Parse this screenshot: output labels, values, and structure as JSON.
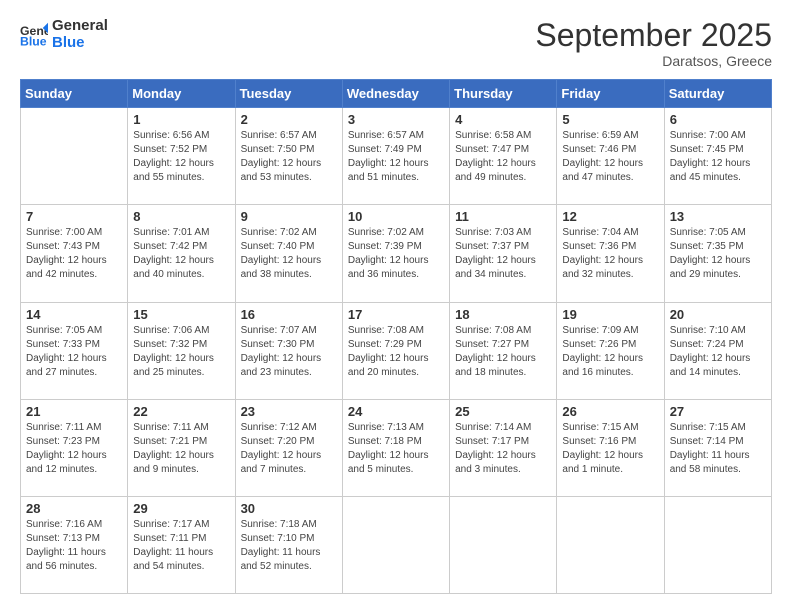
{
  "header": {
    "logo_line1": "General",
    "logo_line2": "Blue",
    "month": "September 2025",
    "location": "Daratsos, Greece"
  },
  "weekdays": [
    "Sunday",
    "Monday",
    "Tuesday",
    "Wednesday",
    "Thursday",
    "Friday",
    "Saturday"
  ],
  "weeks": [
    [
      {
        "day": "",
        "info": ""
      },
      {
        "day": "1",
        "info": "Sunrise: 6:56 AM\nSunset: 7:52 PM\nDaylight: 12 hours\nand 55 minutes."
      },
      {
        "day": "2",
        "info": "Sunrise: 6:57 AM\nSunset: 7:50 PM\nDaylight: 12 hours\nand 53 minutes."
      },
      {
        "day": "3",
        "info": "Sunrise: 6:57 AM\nSunset: 7:49 PM\nDaylight: 12 hours\nand 51 minutes."
      },
      {
        "day": "4",
        "info": "Sunrise: 6:58 AM\nSunset: 7:47 PM\nDaylight: 12 hours\nand 49 minutes."
      },
      {
        "day": "5",
        "info": "Sunrise: 6:59 AM\nSunset: 7:46 PM\nDaylight: 12 hours\nand 47 minutes."
      },
      {
        "day": "6",
        "info": "Sunrise: 7:00 AM\nSunset: 7:45 PM\nDaylight: 12 hours\nand 45 minutes."
      }
    ],
    [
      {
        "day": "7",
        "info": "Sunrise: 7:00 AM\nSunset: 7:43 PM\nDaylight: 12 hours\nand 42 minutes."
      },
      {
        "day": "8",
        "info": "Sunrise: 7:01 AM\nSunset: 7:42 PM\nDaylight: 12 hours\nand 40 minutes."
      },
      {
        "day": "9",
        "info": "Sunrise: 7:02 AM\nSunset: 7:40 PM\nDaylight: 12 hours\nand 38 minutes."
      },
      {
        "day": "10",
        "info": "Sunrise: 7:02 AM\nSunset: 7:39 PM\nDaylight: 12 hours\nand 36 minutes."
      },
      {
        "day": "11",
        "info": "Sunrise: 7:03 AM\nSunset: 7:37 PM\nDaylight: 12 hours\nand 34 minutes."
      },
      {
        "day": "12",
        "info": "Sunrise: 7:04 AM\nSunset: 7:36 PM\nDaylight: 12 hours\nand 32 minutes."
      },
      {
        "day": "13",
        "info": "Sunrise: 7:05 AM\nSunset: 7:35 PM\nDaylight: 12 hours\nand 29 minutes."
      }
    ],
    [
      {
        "day": "14",
        "info": "Sunrise: 7:05 AM\nSunset: 7:33 PM\nDaylight: 12 hours\nand 27 minutes."
      },
      {
        "day": "15",
        "info": "Sunrise: 7:06 AM\nSunset: 7:32 PM\nDaylight: 12 hours\nand 25 minutes."
      },
      {
        "day": "16",
        "info": "Sunrise: 7:07 AM\nSunset: 7:30 PM\nDaylight: 12 hours\nand 23 minutes."
      },
      {
        "day": "17",
        "info": "Sunrise: 7:08 AM\nSunset: 7:29 PM\nDaylight: 12 hours\nand 20 minutes."
      },
      {
        "day": "18",
        "info": "Sunrise: 7:08 AM\nSunset: 7:27 PM\nDaylight: 12 hours\nand 18 minutes."
      },
      {
        "day": "19",
        "info": "Sunrise: 7:09 AM\nSunset: 7:26 PM\nDaylight: 12 hours\nand 16 minutes."
      },
      {
        "day": "20",
        "info": "Sunrise: 7:10 AM\nSunset: 7:24 PM\nDaylight: 12 hours\nand 14 minutes."
      }
    ],
    [
      {
        "day": "21",
        "info": "Sunrise: 7:11 AM\nSunset: 7:23 PM\nDaylight: 12 hours\nand 12 minutes."
      },
      {
        "day": "22",
        "info": "Sunrise: 7:11 AM\nSunset: 7:21 PM\nDaylight: 12 hours\nand 9 minutes."
      },
      {
        "day": "23",
        "info": "Sunrise: 7:12 AM\nSunset: 7:20 PM\nDaylight: 12 hours\nand 7 minutes."
      },
      {
        "day": "24",
        "info": "Sunrise: 7:13 AM\nSunset: 7:18 PM\nDaylight: 12 hours\nand 5 minutes."
      },
      {
        "day": "25",
        "info": "Sunrise: 7:14 AM\nSunset: 7:17 PM\nDaylight: 12 hours\nand 3 minutes."
      },
      {
        "day": "26",
        "info": "Sunrise: 7:15 AM\nSunset: 7:16 PM\nDaylight: 12 hours\nand 1 minute."
      },
      {
        "day": "27",
        "info": "Sunrise: 7:15 AM\nSunset: 7:14 PM\nDaylight: 11 hours\nand 58 minutes."
      }
    ],
    [
      {
        "day": "28",
        "info": "Sunrise: 7:16 AM\nSunset: 7:13 PM\nDaylight: 11 hours\nand 56 minutes."
      },
      {
        "day": "29",
        "info": "Sunrise: 7:17 AM\nSunset: 7:11 PM\nDaylight: 11 hours\nand 54 minutes."
      },
      {
        "day": "30",
        "info": "Sunrise: 7:18 AM\nSunset: 7:10 PM\nDaylight: 11 hours\nand 52 minutes."
      },
      {
        "day": "",
        "info": ""
      },
      {
        "day": "",
        "info": ""
      },
      {
        "day": "",
        "info": ""
      },
      {
        "day": "",
        "info": ""
      }
    ]
  ]
}
